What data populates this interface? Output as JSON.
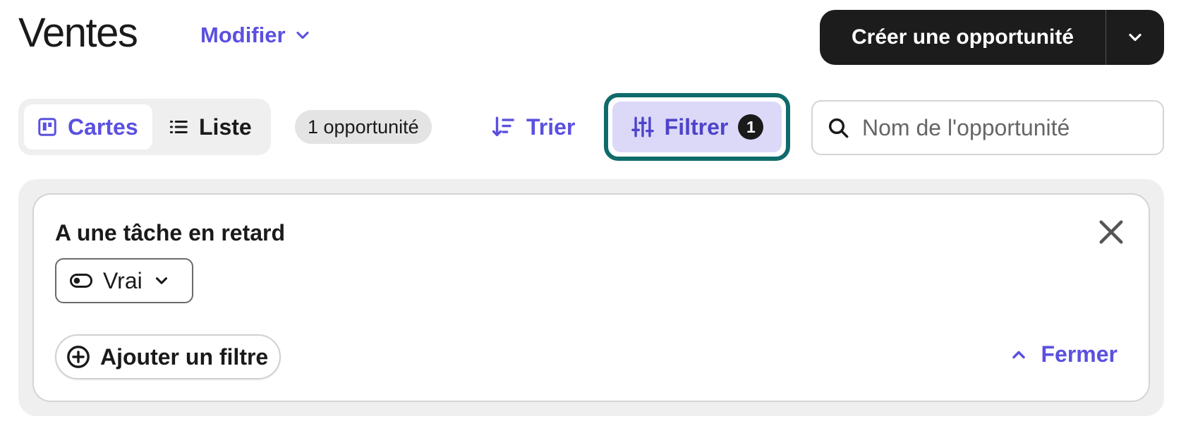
{
  "header": {
    "title": "Ventes",
    "modify_label": "Modifier",
    "create_label": "Créer une opportunité"
  },
  "toolbar": {
    "views": [
      {
        "label": "Cartes",
        "icon": "board-icon",
        "active": true
      },
      {
        "label": "Liste",
        "icon": "list-icon",
        "active": false
      }
    ],
    "count_label": "1 opportunité",
    "sort_label": "Trier",
    "filter_label": "Filtrer",
    "filter_count": "1",
    "search_placeholder": "Nom de l'opportunité",
    "search_value": ""
  },
  "filter_panel": {
    "filters": [
      {
        "label": "A une tâche en retard",
        "value": "Vrai"
      }
    ],
    "add_filter_label": "Ajouter un filtre",
    "close_label": "Fermer"
  },
  "colors": {
    "accent": "#5b50e0",
    "filter_bg": "#dcd9f8",
    "focus_ring": "#0f6b6b",
    "dark_button": "#1c1c1c"
  }
}
